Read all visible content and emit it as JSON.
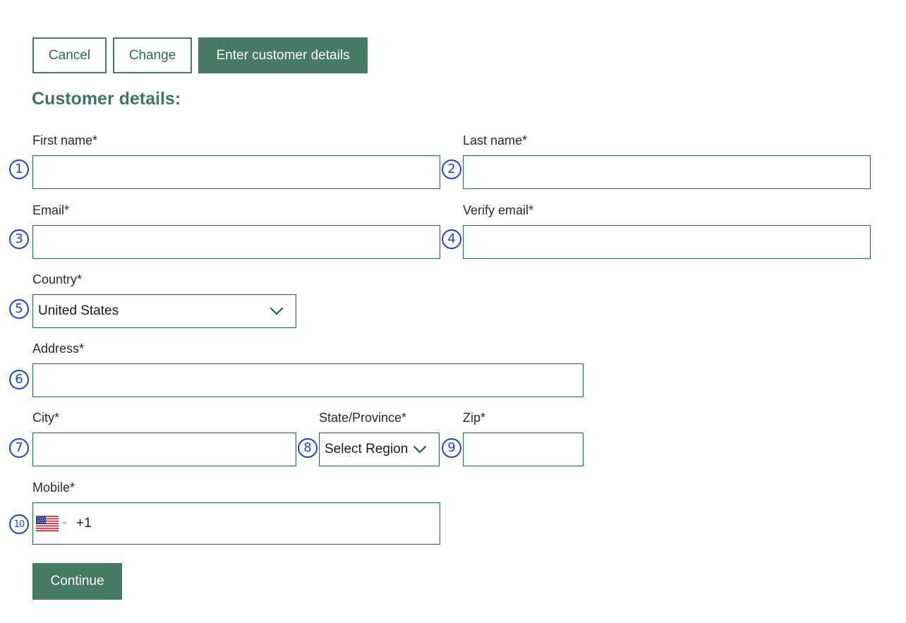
{
  "toolbar": {
    "cancel_label": "Cancel",
    "change_label": "Change",
    "enter_details_label": "Enter customer details"
  },
  "form": {
    "heading": "Customer details:",
    "fields": {
      "first_name": {
        "label": "First name*",
        "value": "",
        "marker": "1"
      },
      "last_name": {
        "label": "Last name*",
        "value": "",
        "marker": "2"
      },
      "email": {
        "label": "Email*",
        "value": "",
        "marker": "3"
      },
      "verify_email": {
        "label": "Verify email*",
        "value": "",
        "marker": "4"
      },
      "country": {
        "label": "Country*",
        "selected": "United States",
        "marker": "5"
      },
      "address": {
        "label": "Address*",
        "value": "",
        "marker": "6"
      },
      "city": {
        "label": "City*",
        "value": "",
        "marker": "7"
      },
      "state": {
        "label": "State/Province*",
        "selected": "Select Region",
        "marker": "8"
      },
      "zip": {
        "label": "Zip*",
        "value": "",
        "marker": "9"
      },
      "mobile": {
        "label": "Mobile*",
        "dial_code": "+1",
        "flag": "us-flag-icon",
        "marker": "10"
      }
    },
    "continue_label": "Continue"
  },
  "colors": {
    "accent": "#467966",
    "heading": "#3d7563",
    "marker": "#1845d6"
  }
}
